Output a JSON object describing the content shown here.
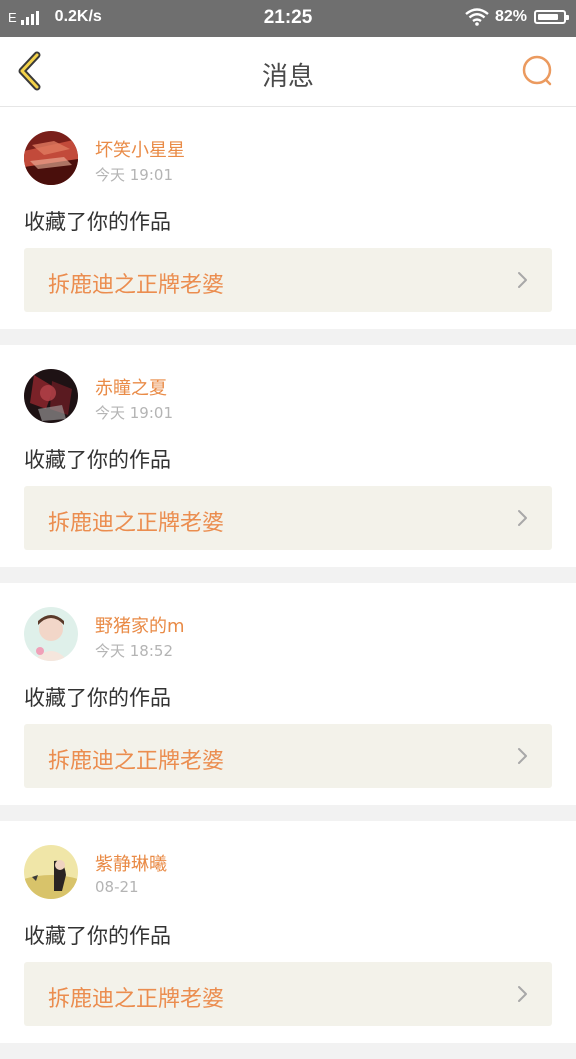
{
  "status_bar": {
    "network_type": "E",
    "speed": "0.2K/s",
    "time": "21:25",
    "battery_percent": "82%",
    "battery_level": 0.82
  },
  "header": {
    "title": "消息",
    "back_icon": "chevron-left-icon",
    "search_icon": "search-icon",
    "accent_color": "#e98b47"
  },
  "messages": [
    {
      "user_name": "坏笑小星星",
      "time": "今天 19:01",
      "action": "收藏了你的作品",
      "work_title": "拆鹿迪之正牌老婆"
    },
    {
      "user_name": "赤瞳之夏",
      "time": "今天 19:01",
      "action": "收藏了你的作品",
      "work_title": "拆鹿迪之正牌老婆"
    },
    {
      "user_name": "野猪家的m",
      "time": "今天 18:52",
      "action": "收藏了你的作品",
      "work_title": "拆鹿迪之正牌老婆"
    },
    {
      "user_name": "紫静琳曦",
      "time": "08-21",
      "action": "收藏了你的作品",
      "work_title": "拆鹿迪之正牌老婆"
    }
  ]
}
